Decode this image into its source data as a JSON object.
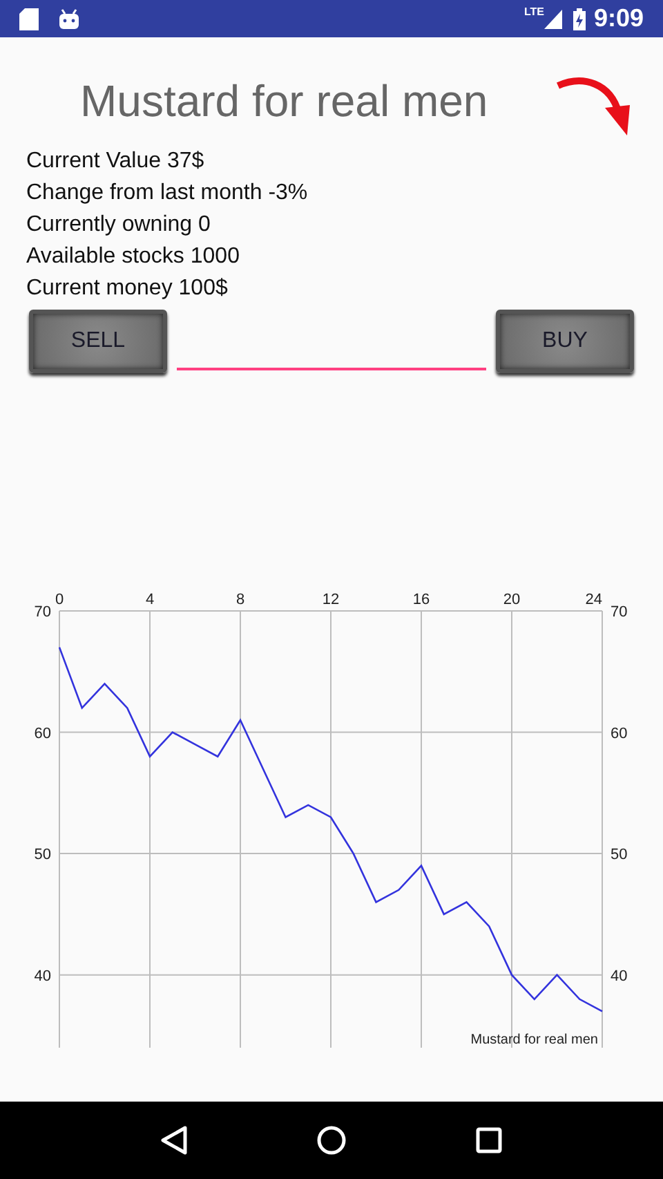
{
  "status_bar": {
    "network": "LTE",
    "time": "9:09"
  },
  "title": "Mustard for real men",
  "info_lines": [
    "Current Value 37$",
    "Change from last month -3%",
    "Currently owning 0",
    "Available stocks 1000",
    "Current money 100$"
  ],
  "buttons": {
    "sell": "SELL",
    "buy": "BUY"
  },
  "chart": {
    "chart_data": {
      "type": "line",
      "x": [
        0,
        1,
        2,
        3,
        4,
        5,
        6,
        7,
        8,
        9,
        10,
        11,
        12,
        13,
        14,
        15,
        16,
        17,
        18,
        19,
        20,
        21,
        22,
        23,
        24
      ],
      "series": [
        {
          "name": "Mustard for real men",
          "color": "#3333dd",
          "values": [
            67,
            62,
            64,
            62,
            58,
            60,
            59,
            58,
            61,
            57,
            53,
            54,
            53,
            50,
            46,
            47,
            49,
            45,
            46,
            44,
            40,
            38,
            40,
            38,
            37
          ]
        }
      ],
      "xlim": [
        0,
        24
      ],
      "ylim": [
        34,
        70
      ],
      "xticks": [
        0,
        4,
        8,
        12,
        16,
        20,
        24
      ],
      "yticks": [
        40,
        50,
        60,
        70
      ],
      "grid": true
    },
    "right_axis_labels": [
      "70",
      "60",
      "50",
      "40"
    ]
  }
}
